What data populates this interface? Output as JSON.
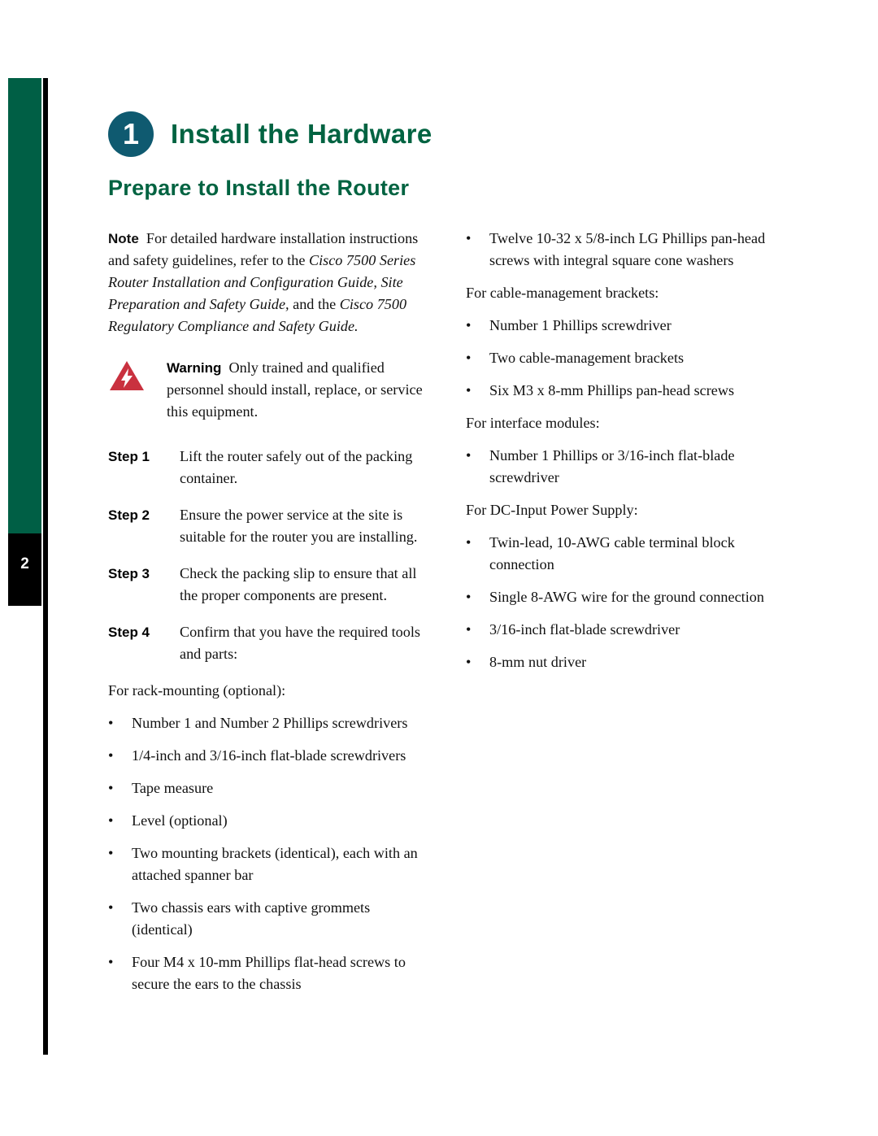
{
  "page": {
    "number": "2",
    "accent_green": "#006341",
    "badge_teal": "#0f5a70",
    "warning_red": "#c9313f"
  },
  "heading": {
    "step_badge": "1",
    "title": "Install the Hardware",
    "subtitle": "Prepare to Install the Router"
  },
  "note": {
    "label": "Note",
    "text_part1": "For detailed hardware installation instructions and safety guidelines, refer to the ",
    "text_italic1": "Cisco 7500 Series Router Installation and Configuration Guide, Site Preparation and Safety Guide,",
    "text_part2": " and the ",
    "text_italic2": "Cisco 7500 Regulatory Compliance and Safety Guide."
  },
  "warning": {
    "icon": "warning-triangle-icon",
    "label": "Warning",
    "text": "Only trained and qualified personnel should install, replace, or service this equipment."
  },
  "steps": [
    {
      "label": "Step 1",
      "text": "Lift the router safely out of the packing container."
    },
    {
      "label": "Step 2",
      "text": "Ensure the power service at the site is suitable for the router you are installing."
    },
    {
      "label": "Step 3",
      "text": "Check the packing slip to ensure that all the proper components are present."
    },
    {
      "label": "Step 4",
      "text": "Confirm that you have the required tools and parts:"
    }
  ],
  "left_column": {
    "rack_heading": "For rack-mounting (optional):",
    "rack_items": [
      "Number 1 and Number 2 Phillips screwdrivers",
      "1/4-inch and 3/16-inch flat-blade screwdrivers",
      "Tape measure",
      "Level (optional)",
      "Two mounting brackets (identical), each with an attached spanner bar",
      "Two chassis ears with captive grommets (identical)",
      "Four M4 x 10-mm Phillips flat-head screws to secure the ears to the chassis"
    ]
  },
  "right_column": {
    "rack_items_continued": [
      "Twelve 10-32 x 5/8-inch LG Phillips pan-head screws with integral square cone washers"
    ],
    "cable_heading": "For cable-management brackets:",
    "cable_items": [
      "Number 1 Phillips screwdriver",
      "Two cable-management brackets",
      "Six M3 x 8-mm Phillips pan-head screws"
    ],
    "interface_heading": "For interface modules:",
    "interface_items": [
      "Number 1 Phillips or 3/16-inch flat-blade screwdriver"
    ],
    "dc_heading": "For DC-Input Power Supply:",
    "dc_items": [
      "Twin-lead, 10-AWG cable terminal block connection",
      "Single 8-AWG wire for the ground connection",
      "3/16-inch flat-blade screwdriver",
      "8-mm nut driver"
    ]
  },
  "bullet_glyph": "•"
}
